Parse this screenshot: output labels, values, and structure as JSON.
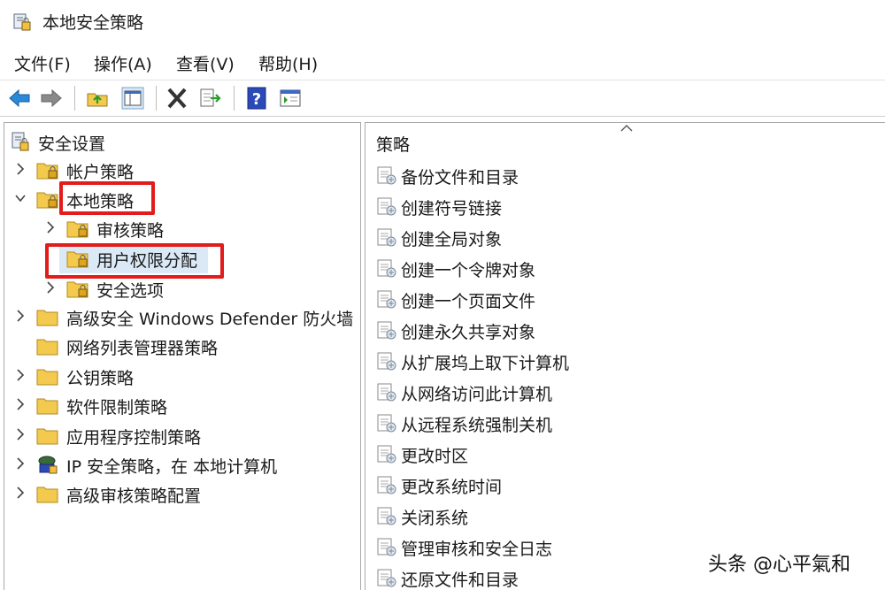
{
  "window": {
    "title": "本地安全策略"
  },
  "menu": [
    "文件(F)",
    "操作(A)",
    "查看(V)",
    "帮助(H)"
  ],
  "toolbar": {
    "buttons": [
      "back-icon",
      "forward-icon",
      "up-folder-icon",
      "show-hide-tree-icon",
      "delete-icon",
      "export-list-icon",
      "help-icon",
      "properties-icon"
    ]
  },
  "tree": {
    "root": "安全设置",
    "items": [
      {
        "label": "帐户策略"
      },
      {
        "label": "本地策略"
      },
      {
        "label": "审核策略"
      },
      {
        "label": "用户权限分配"
      },
      {
        "label": "安全选项"
      },
      {
        "label": "高级安全 Windows Defender 防火墙"
      },
      {
        "label": "网络列表管理器策略"
      },
      {
        "label": "公钥策略"
      },
      {
        "label": "软件限制策略"
      },
      {
        "label": "应用程序控制策略"
      },
      {
        "label": "IP 安全策略，在 本地计算机"
      },
      {
        "label": "高级审核策略配置"
      }
    ]
  },
  "list": {
    "column_header": "策略",
    "items": [
      "备份文件和目录",
      "创建符号链接",
      "创建全局对象",
      "创建一个令牌对象",
      "创建一个页面文件",
      "创建永久共享对象",
      "从扩展坞上取下计算机",
      "从网络访问此计算机",
      "从远程系统强制关机",
      "更改时区",
      "更改系统时间",
      "关闭系统",
      "管理审核和安全日志",
      "还原文件和目录"
    ]
  },
  "watermark": "头条 @心平氣和",
  "colors": {
    "highlight": "#e21b1b",
    "selection": "#dbe9f7",
    "folder": "#f3c94e"
  }
}
